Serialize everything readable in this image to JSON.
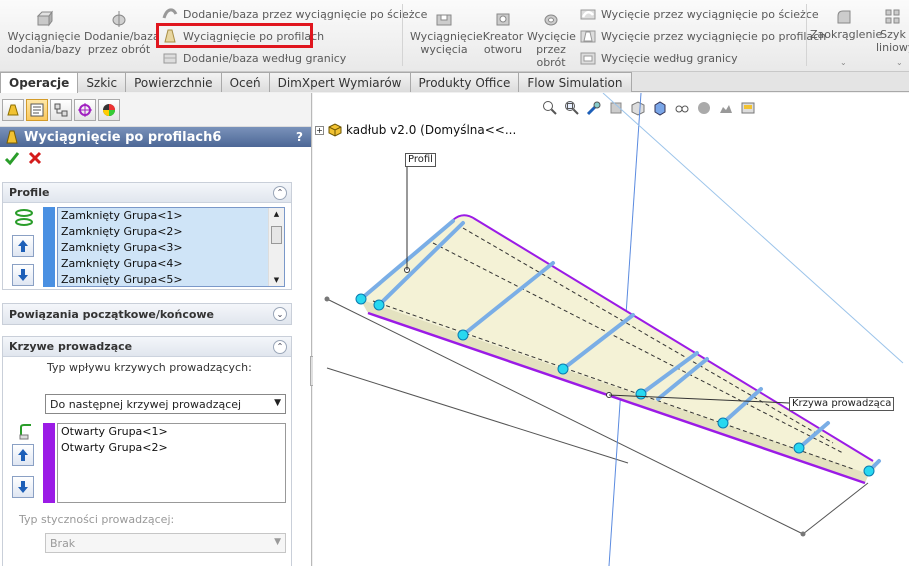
{
  "ribbon": {
    "btn_boss_extrude": "Wyciągnięcie dodania/bazy",
    "btn_boss_revolve": "Dodanie/baza przez obrót",
    "small_sweep": "Dodanie/baza przez wyciągnięcie po ścieżce",
    "small_loft": "Wyciągnięcie po profilach",
    "small_boundary": "Dodanie/baza według granicy",
    "btn_cut_extrude": "Wyciągnięcie wycięcia",
    "btn_hole_wizard": "Kreator otworu",
    "btn_cut_revolve": "Wycięcie przez obrót",
    "small_cut_sweep": "Wycięcie przez wyciągnięcie po ścieżce",
    "small_cut_loft": "Wycięcie przez wyciągnięcie po profilach",
    "small_cut_boundary": "Wycięcie według granicy",
    "btn_fillet": "Zaokrąglenie",
    "btn_linear_pattern": "Szyk liniowy"
  },
  "tabs": [
    "Operacje",
    "Szkic",
    "Powierzchnie",
    "Oceń",
    "DimXpert Wymiarów",
    "Produkty Office",
    "Flow Simulation"
  ],
  "feature": {
    "title": "Wyciągnięcie po profilach6",
    "help": "?"
  },
  "profiles": {
    "header": "Profile",
    "items": [
      "Zamknięty Grupa<1>",
      "Zamknięty Grupa<2>",
      "Zamknięty Grupa<3>",
      "Zamknięty Grupa<4>",
      "Zamknięty Grupa<5>"
    ]
  },
  "constraints": {
    "header": "Powiązania początkowe/końcowe"
  },
  "guides": {
    "header": "Krzywe prowadzące",
    "influence_label": "Typ wpływu krzywych prowadzących:",
    "influence_value": "Do następnej krzywej prowadzącej",
    "items": [
      "Otwarty Grupa<1>",
      "Otwarty Grupa<2>"
    ],
    "tangency_label": "Typ styczności prowadzącej:",
    "tangency_value": "Brak"
  },
  "viewport": {
    "tree_label": "kadłub v2.0  (Domyślna<<...",
    "callout_profile": "Profil",
    "callout_guide": "Krzywa prowadząca"
  },
  "colors": {
    "profile_bar": "#4a90e2",
    "guide_bar": "#9b1be6",
    "highlight": "#e0161e",
    "panel_title": "#4c6796"
  }
}
